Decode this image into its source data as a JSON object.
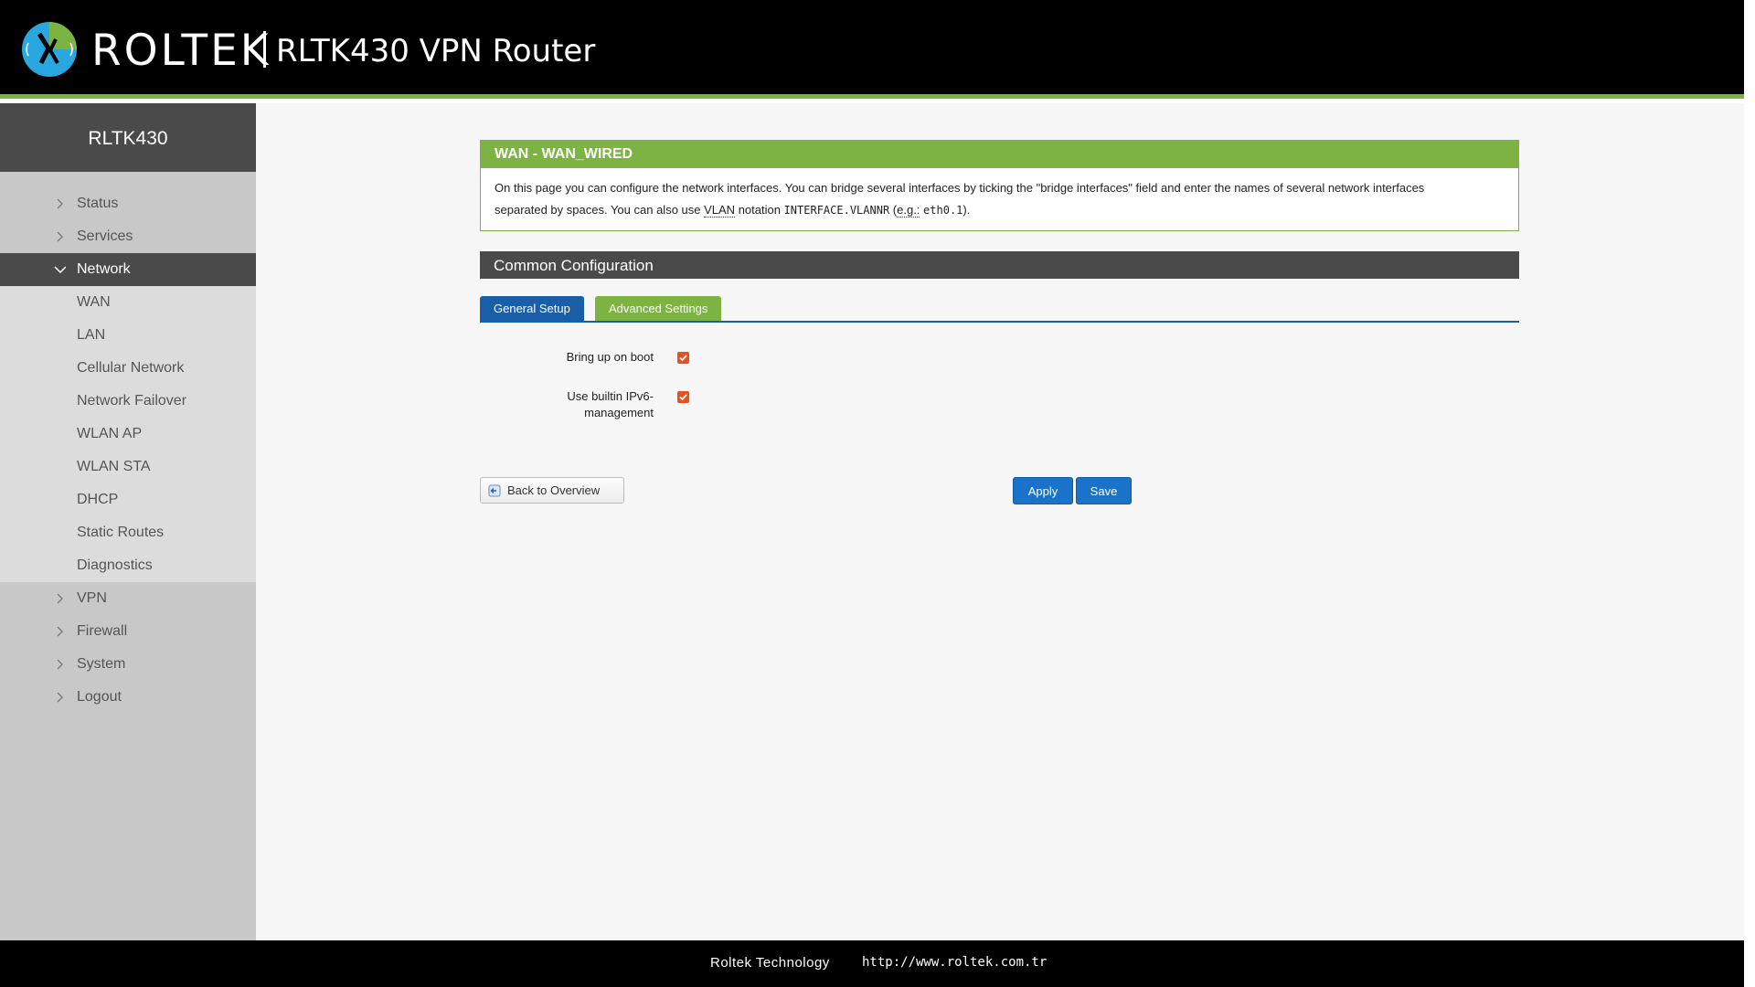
{
  "header": {
    "brand": "ROLTEK",
    "product": "RLTK430 VPN Router"
  },
  "sidebar": {
    "device": "RLTK430",
    "items": [
      {
        "label": "Status"
      },
      {
        "label": "Services"
      },
      {
        "label": "Network",
        "expanded": true
      },
      {
        "label": "VPN"
      },
      {
        "label": "Firewall"
      },
      {
        "label": "System"
      },
      {
        "label": "Logout"
      }
    ],
    "network_sub": [
      "WAN",
      "LAN",
      "Cellular Network",
      "Network Failover",
      "WLAN AP",
      "WLAN STA",
      "DHCP",
      "Static Routes",
      "Diagnostics"
    ]
  },
  "panel": {
    "title": "WAN - WAN_WIRED",
    "line1": "On this page you can configure the network interfaces. You can bridge several interfaces by ticking the \"bridge interfaces\" field and enter the names of several network interfaces",
    "line2_a": "separated by spaces. You can also use ",
    "line2_vlan": "VLAN",
    "line2_b": " notation ",
    "line2_code": "INTERFACE.VLANNR",
    "line2_c": " (",
    "line2_eg": "e.g.:",
    "line2_d": " ",
    "line2_example": "eth0.1",
    "line2_e": ")."
  },
  "section": {
    "title": "Common Configuration"
  },
  "tabs": {
    "general": "General Setup",
    "advanced": "Advanced Settings"
  },
  "form": {
    "boot_label": "Bring up on boot",
    "boot_checked": true,
    "ipv6_label_1": "Use builtin IPv6-",
    "ipv6_label_2": "management",
    "ipv6_checked": true
  },
  "buttons": {
    "back": "Back to Overview",
    "apply": "Apply",
    "save": "Save"
  },
  "footer": {
    "company": "Roltek Technology",
    "url": "http://www.roltek.com.tr"
  },
  "colors": {
    "accent_green": "#7cb342",
    "dark_bar": "#4a4a4a",
    "blue": "#1a5ea8",
    "checkbox": "#e8501e"
  }
}
